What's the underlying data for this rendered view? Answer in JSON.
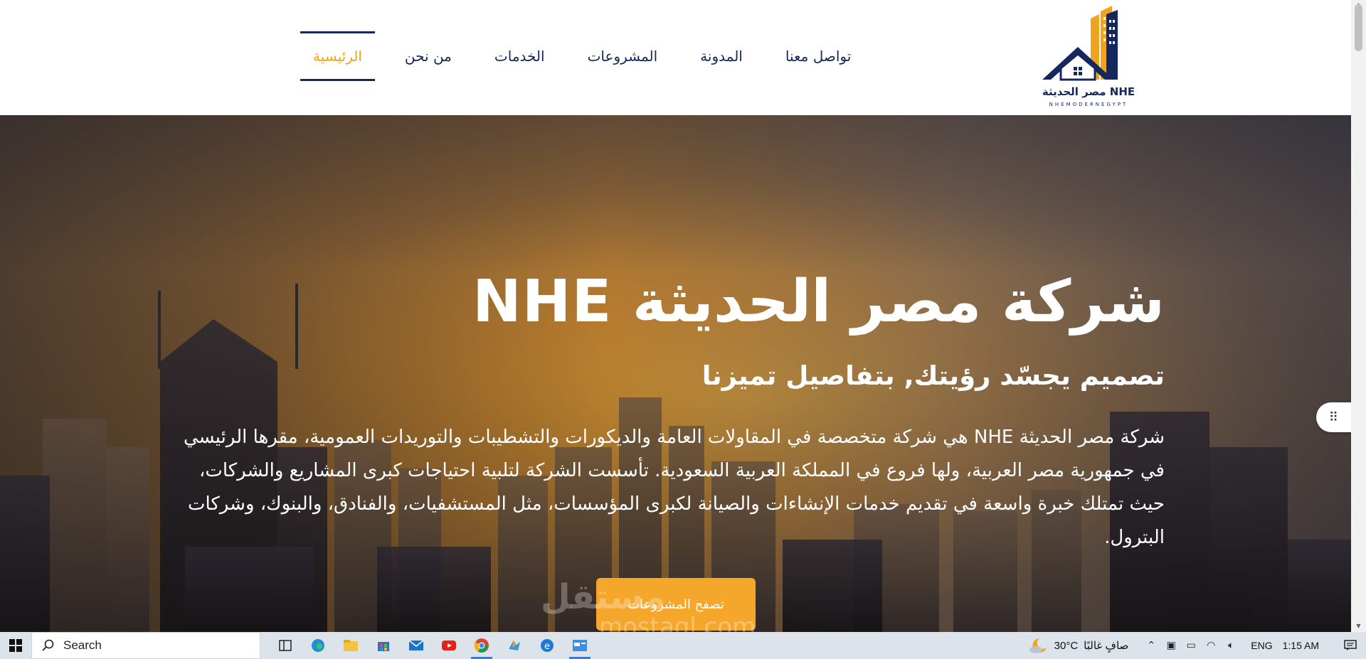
{
  "header": {
    "logo_text": "NHE مصر الحديثة",
    "logo_sub": "NHEMODERNEGYPT",
    "nav": [
      {
        "label": "الرئيسية",
        "active": true
      },
      {
        "label": "من نحن",
        "active": false
      },
      {
        "label": "الخدمات",
        "active": false
      },
      {
        "label": "المشروعات",
        "active": false
      },
      {
        "label": "المدونة",
        "active": false
      },
      {
        "label": "تواصل معنا",
        "active": false
      }
    ]
  },
  "hero": {
    "title": "شركة مصر الحديثة NHE",
    "subtitle": "تصميم يجسّد رؤيتك, بتفاصيل تميزنا",
    "description": "شركة مصر الحديثة NHE هي شركة متخصصة في المقاولات العامة والديكورات والتشطيبات والتوريدات العمومية، مقرها الرئيسي في جمهورية مصر العربية، ولها فروع في المملكة العربية السعودية. تأسست الشركة لتلبية احتياجات كبرى المشاريع والشركات، حيث تمتلك خبرة واسعة في تقديم خدمات الإنشاءات والصيانة لكبرى المؤسسات، مثل المستشفيات، والفنادق، والبنوك، وشركات البترول.",
    "button_label": "تصفح المشروعات",
    "watermark": "مستقل",
    "watermark_url": "mostaql.com"
  },
  "colors": {
    "brand_navy": "#14275f",
    "brand_orange": "#f0a31e",
    "button": "#f5a72b"
  },
  "taskbar": {
    "search_label": "Search",
    "weather_temp": "30°C",
    "weather_text": "صافٍ غالبًا",
    "language": "ENG",
    "time": "1:15 AM",
    "apps": [
      "task-view-icon",
      "edge-icon",
      "file-explorer-icon",
      "store-icon",
      "mail-icon",
      "youtube-icon",
      "chrome-icon",
      "app-icon",
      "edge-browser-icon",
      "app-window-icon"
    ]
  }
}
